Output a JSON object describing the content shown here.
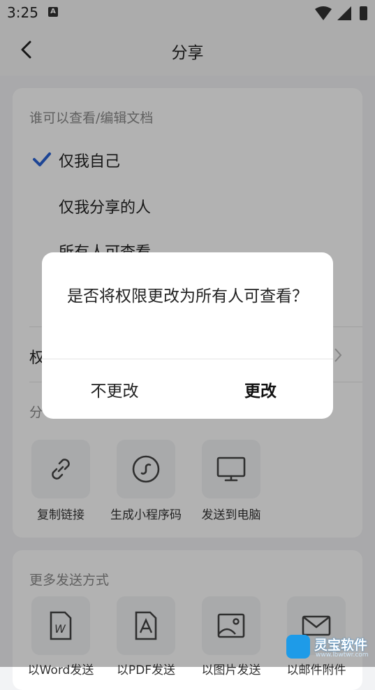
{
  "status_bar": {
    "time": "3:25",
    "notification_icon": "A"
  },
  "header": {
    "title": "分享",
    "back_icon": "chevron-left-icon"
  },
  "permission": {
    "section_title": "谁可以查看/编辑文档",
    "options": [
      {
        "label": "仅我自己",
        "selected": true
      },
      {
        "label": "仅我分享的人",
        "selected": false
      },
      {
        "label": "所有人可查看",
        "selected": false
      }
    ],
    "row_label": "权"
  },
  "share": {
    "section_title": "分",
    "items": [
      {
        "label": "复制链接",
        "icon": "link-icon"
      },
      {
        "label": "生成小程序码",
        "icon": "mini-program-icon"
      },
      {
        "label": "发送到电脑",
        "icon": "monitor-icon"
      }
    ]
  },
  "more": {
    "section_title": "更多发送方式",
    "items": [
      {
        "label": "以Word发送",
        "icon": "word-icon"
      },
      {
        "label": "以PDF发送",
        "icon": "pdf-icon"
      },
      {
        "label": "以图片发送",
        "icon": "image-icon"
      },
      {
        "label": "以邮件附件",
        "icon": "mail-icon"
      }
    ]
  },
  "dialog": {
    "message": "是否将权限更改为所有人可查看？",
    "cancel_label": "不更改",
    "confirm_label": "更改"
  },
  "watermark": {
    "name": "灵宝软件",
    "url": "www.lbwtwr.com"
  },
  "colors": {
    "accent": "#2a63d6",
    "overlay": "rgba(0,0,0,0.30)"
  }
}
